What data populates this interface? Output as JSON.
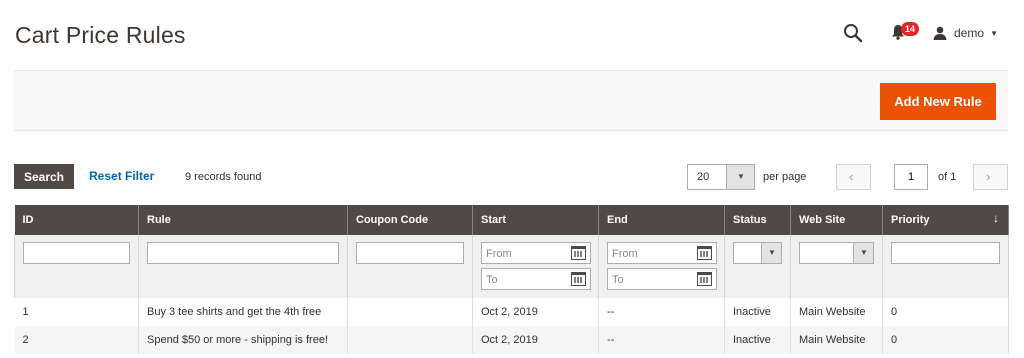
{
  "page": {
    "title": "Cart Price Rules"
  },
  "header": {
    "notifications_count": "14",
    "user_name": "demo",
    "icons": {
      "search": "search-icon",
      "bell": "bell-icon",
      "user": "user-icon",
      "caret": "chevron-down-icon"
    }
  },
  "actions": {
    "add_new_label": "Add New Rule"
  },
  "grid_controls": {
    "search_label": "Search",
    "reset_filter_label": "Reset Filter",
    "records_found": "9 records found",
    "per_page_value": "20",
    "per_page_label": "per page",
    "current_page": "1",
    "of_pages": "of 1"
  },
  "columns": [
    {
      "label": "ID"
    },
    {
      "label": "Rule"
    },
    {
      "label": "Coupon Code"
    },
    {
      "label": "Start"
    },
    {
      "label": "End"
    },
    {
      "label": "Status"
    },
    {
      "label": "Web Site"
    },
    {
      "label": "Priority"
    }
  ],
  "filters": {
    "start_from_placeholder": "From",
    "start_to_placeholder": "To",
    "end_from_placeholder": "From",
    "end_to_placeholder": "To"
  },
  "rows": [
    {
      "id": "1",
      "rule": "Buy 3 tee shirts and get the 4th free",
      "coupon": "",
      "start": "Oct 2, 2019",
      "end": "--",
      "status": "Inactive",
      "website": "Main Website",
      "priority": "0"
    },
    {
      "id": "2",
      "rule": "Spend $50 or more - shipping is free!",
      "coupon": "",
      "start": "Oct 2, 2019",
      "end": "--",
      "status": "Inactive",
      "website": "Main Website",
      "priority": "0"
    }
  ],
  "colors": {
    "accent": "#eb5202",
    "header_dark": "#514943",
    "link": "#006bb4",
    "badge": "#e22626"
  }
}
